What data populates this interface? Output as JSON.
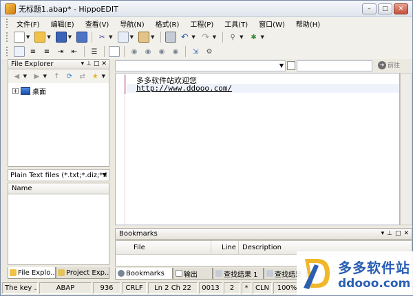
{
  "window": {
    "title": "无标题1.abap* - HippoEDIT",
    "controls": [
      "–",
      "□",
      "✕"
    ]
  },
  "menu": [
    "文件(F)",
    "编辑(E)",
    "查看(V)",
    "导航(N)",
    "格式(R)",
    "工程(P)",
    "工具(T)",
    "窗口(W)",
    "帮助(H)"
  ],
  "left_panel": {
    "title": "File Explorer",
    "tree": [
      {
        "label": "桌面"
      }
    ],
    "filter": "Plain Text files (*.txt;*.diz;*.l",
    "list_header": "Name",
    "tabs": [
      "File Explo...",
      "Project Exp..."
    ]
  },
  "editor": {
    "lines": [
      "多多软件站欢迎您",
      "http://www.ddooo.com/"
    ],
    "nav_label": "前往"
  },
  "bookmarks": {
    "title": "Bookmarks",
    "columns": [
      "File",
      "Line",
      "Description"
    ]
  },
  "bottom_tabs": [
    "Bookmarks",
    "输出",
    "查找结果 1",
    "查找结果 2"
  ],
  "statusbar": [
    "The key ...",
    "ABAP",
    "936",
    "CRLF",
    "Ln 2 Ch 22",
    "0013",
    "2",
    "*",
    "CLN",
    "100%"
  ],
  "watermark": {
    "title": "多多软件站",
    "url": "ddooo.com"
  },
  "colors": {
    "titlebar": "#dfe5ee",
    "accent": "#2a5fb4",
    "current_line": "#eef2fb"
  }
}
